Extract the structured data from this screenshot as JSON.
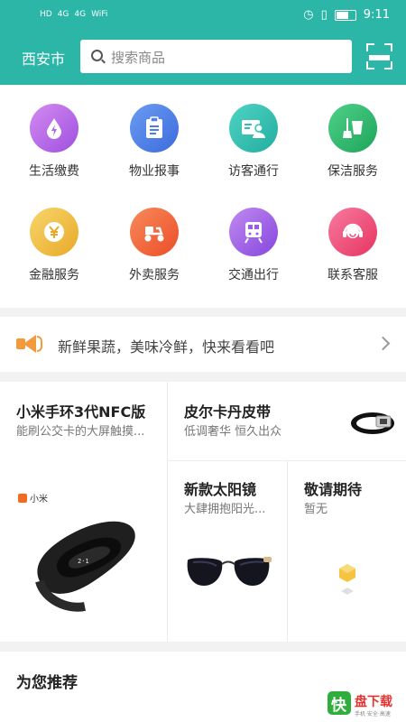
{
  "status_bar": {
    "left_items": [
      "HD",
      "4G",
      "4G",
      "WiFi"
    ],
    "time": "9:11"
  },
  "header": {
    "city": "西安市",
    "search_placeholder": "搜索商品",
    "scan_icon": "scan-icon"
  },
  "services": [
    {
      "label": "生活缴费",
      "icon": "droplet-bolt-icon",
      "color": "#b167e8"
    },
    {
      "label": "物业报事",
      "icon": "clipboard-icon",
      "color": "#4b7fe6"
    },
    {
      "label": "访客通行",
      "icon": "visitor-card-icon",
      "color": "#2cc1b2"
    },
    {
      "label": "保洁服务",
      "icon": "broom-bucket-icon",
      "color": "#27b86a"
    },
    {
      "label": "金融服务",
      "icon": "yen-coin-icon",
      "color": "#f0bd3f"
    },
    {
      "label": "外卖服务",
      "icon": "scooter-icon",
      "color": "#f36a3c"
    },
    {
      "label": "交通出行",
      "icon": "train-icon",
      "color": "#9d5ce6"
    },
    {
      "label": "联系客服",
      "icon": "headset-icon",
      "color": "#f04f7a"
    }
  ],
  "notice": {
    "text": "新鲜果蔬，美味冷鲜，快来看看吧"
  },
  "promo": {
    "main": {
      "title": "小米手环3代NFC版",
      "subtitle": "能刷公交卡的大屏触摸...",
      "brand": "小米"
    },
    "top_right": {
      "title": "皮尔卡丹皮带",
      "subtitle": "低调奢华 恒久出众"
    },
    "bottom_mid": {
      "title": "新款太阳镜",
      "subtitle": "大肆拥抱阳光..."
    },
    "bottom_right": {
      "title": "敬请期待",
      "subtitle": "暂无"
    }
  },
  "recommend": {
    "title": "为您推荐"
  },
  "watermark": {
    "brand": "快",
    "text": "盘下载",
    "sub": "手机·安全·高速"
  },
  "colors": {
    "accent": "#2bb6a8"
  }
}
